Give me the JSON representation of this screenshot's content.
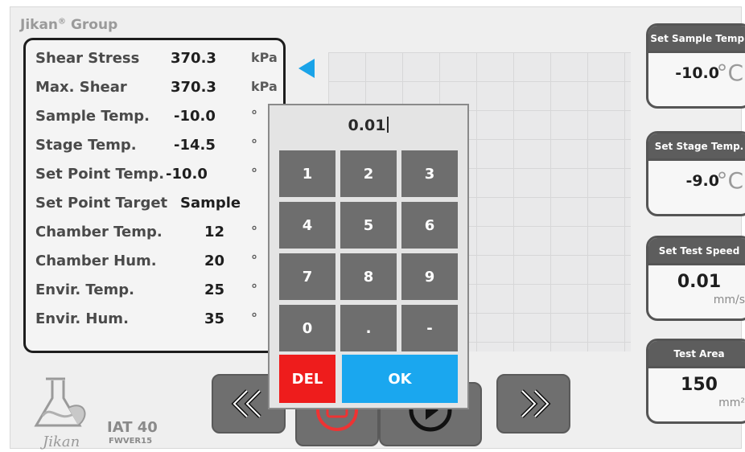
{
  "brand": {
    "name": "Jikan",
    "mark": "®",
    "suffix": "Group"
  },
  "readings": [
    {
      "label": "Shear Stress",
      "value": "370.3",
      "unit": "kPa"
    },
    {
      "label": "Max. Shear",
      "value": "370.3",
      "unit": "kPa"
    },
    {
      "label": "Sample Temp.",
      "value": "-10.0",
      "unit": "°"
    },
    {
      "label": "Stage Temp.",
      "value": "-14.5",
      "unit": "°"
    },
    {
      "label": "Set Point Temp.",
      "value": "-10.0",
      "unit": "°"
    },
    {
      "label": "Set Point Target",
      "value": "Sample",
      "unit": ""
    },
    {
      "label": "Chamber Temp.",
      "value": "12",
      "unit": "°"
    },
    {
      "label": "Chamber Hum.",
      "value": "20",
      "unit": "°"
    },
    {
      "label": "Envir. Temp.",
      "value": "25",
      "unit": "°"
    },
    {
      "label": "Envir. Hum.",
      "value": "35",
      "unit": "°"
    }
  ],
  "settings": {
    "sample_temp": {
      "title": "Set Sample Temp.",
      "value": "-10.0",
      "unit": "°C"
    },
    "stage_temp": {
      "title": "Set Stage Temp.",
      "value": "-9.0",
      "unit": "°C"
    },
    "test_speed": {
      "title": "Set Test Speed",
      "value": "0.01",
      "unit": "mm/s"
    },
    "test_area": {
      "title": "Test Area",
      "value": "150",
      "unit": "mm²"
    }
  },
  "keypad": {
    "display": "0.01",
    "keys": [
      "1",
      "2",
      "3",
      "4",
      "5",
      "6",
      "7",
      "8",
      "9",
      "0",
      ".",
      "-"
    ],
    "del_label": "DEL",
    "ok_label": "OK"
  },
  "footer": {
    "logo_text": "Jikan",
    "model": "IAT 40",
    "firmware": "FWVER15"
  },
  "colors": {
    "accent": "#1aa7ef",
    "danger": "#ee1c1c",
    "key": "#6e6e6e"
  }
}
